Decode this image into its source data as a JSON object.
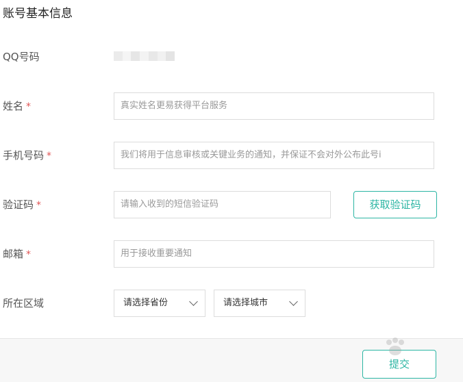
{
  "page": {
    "title": "账号基本信息"
  },
  "fields": {
    "qq": {
      "label": "QQ号码"
    },
    "name": {
      "label": "姓名",
      "required_mark": "*",
      "placeholder": "真实姓名更易获得平台服务"
    },
    "phone": {
      "label": "手机号码",
      "required_mark": "*",
      "placeholder": "我们将用于信息审核或关键业务的通知，并保证不会对外公布此号i"
    },
    "code": {
      "label": "验证码",
      "required_mark": "*",
      "placeholder": "请输入收到的短信验证码",
      "button_label": "获取验证码"
    },
    "email": {
      "label": "邮箱",
      "required_mark": "*",
      "placeholder": "用于接收重要通知"
    },
    "region": {
      "label": "所在区域",
      "province_value": "请选择省份",
      "city_value": "请选择城市"
    }
  },
  "footer": {
    "submit_label": "提交"
  },
  "colors": {
    "accent": "#2bb5a3",
    "required": "#e05555",
    "border": "#dcdcdc",
    "footer_bg": "#f7f7f7"
  }
}
